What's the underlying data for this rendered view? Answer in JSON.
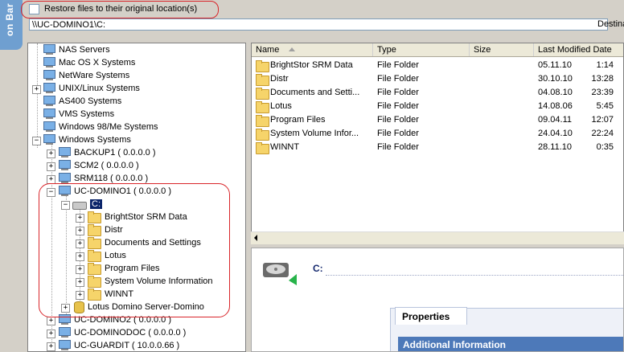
{
  "side_tab": {
    "label": "on Bar"
  },
  "restore": {
    "label": "Restore files to their original location(s)",
    "checked": false
  },
  "path": {
    "value": "\\\\UC-DOMINO1\\C:"
  },
  "destination": {
    "label": "Destina"
  },
  "tree": {
    "items": [
      {
        "label": "NAS Servers",
        "icon": "nas-server-icon"
      },
      {
        "label": "Mac OS X Systems",
        "icon": "computer-icon"
      },
      {
        "label": "NetWare Systems",
        "icon": "computer-icon"
      },
      {
        "label": "UNIX/Linux Systems",
        "icon": "computer-icon"
      },
      {
        "label": "AS400 Systems",
        "icon": "computer-icon"
      },
      {
        "label": "VMS Systems",
        "icon": "computer-icon"
      },
      {
        "label": "Windows 98/Me Systems",
        "icon": "computer-icon"
      },
      {
        "label": "Windows Systems",
        "icon": "computer-icon"
      },
      {
        "label": "BACKUP1 ( 0.0.0.0 )",
        "icon": "computer-icon"
      },
      {
        "label": "SCM2 ( 0.0.0.0 )",
        "icon": "computer-icon"
      },
      {
        "label": "SRM118 ( 0.0.0.0 )",
        "icon": "computer-icon"
      },
      {
        "label": "UC-DOMINO1 ( 0.0.0.0 )",
        "icon": "computer-icon"
      },
      {
        "label": "C:",
        "icon": "drive-icon"
      },
      {
        "label": "BrightStor SRM Data",
        "icon": "folder-icon"
      },
      {
        "label": "Distr",
        "icon": "folder-icon"
      },
      {
        "label": "Documents and Settings",
        "icon": "folder-icon"
      },
      {
        "label": "Lotus",
        "icon": "folder-icon"
      },
      {
        "label": "Program Files",
        "icon": "folder-icon"
      },
      {
        "label": "System Volume Information",
        "icon": "folder-icon"
      },
      {
        "label": "WINNT",
        "icon": "folder-icon"
      },
      {
        "label": "Lotus Domino Server-Domino",
        "icon": "database-icon"
      },
      {
        "label": "UC-DOMINO2 ( 0.0.0.0 )",
        "icon": "computer-icon"
      },
      {
        "label": "UC-DOMINODOC ( 0.0.0.0 )",
        "icon": "computer-icon"
      },
      {
        "label": "UC-GUARDIT ( 10.0.0.66 )",
        "icon": "computer-icon"
      }
    ]
  },
  "file_list": {
    "columns": [
      "Name",
      "Type",
      "Size",
      "Last Modified Date"
    ],
    "rows": [
      {
        "name": "BrightStor SRM Data",
        "type": "File Folder",
        "size": "",
        "date": "05.11.10",
        "time": "1:14"
      },
      {
        "name": "Distr",
        "type": "File Folder",
        "size": "",
        "date": "30.10.10",
        "time": "13:28"
      },
      {
        "name": "Documents and Setti...",
        "type": "File Folder",
        "size": "",
        "date": "04.08.10",
        "time": "23:39"
      },
      {
        "name": "Lotus",
        "type": "File Folder",
        "size": "",
        "date": "14.08.06",
        "time": "5:45"
      },
      {
        "name": "Program Files",
        "type": "File Folder",
        "size": "",
        "date": "09.04.11",
        "time": "12:07"
      },
      {
        "name": "System Volume Infor...",
        "type": "File Folder",
        "size": "",
        "date": "24.04.10",
        "time": "22:24"
      },
      {
        "name": "WINNT",
        "type": "File Folder",
        "size": "",
        "date": "28.11.10",
        "time": "0:35"
      }
    ]
  },
  "details": {
    "title": "C:",
    "tab_label": "Properties",
    "section_label": "Additional Information"
  },
  "colors": {
    "selection": "#0a246a",
    "highlight_oval": "#d9252a",
    "section_bar": "#4d79b9"
  }
}
